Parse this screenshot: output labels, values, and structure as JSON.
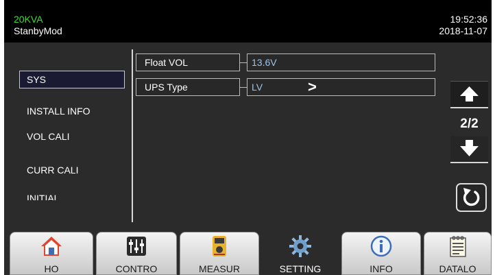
{
  "status": {
    "capacity": "20KVA",
    "mode": "StanbyMod",
    "time": "19:52:36",
    "date": "2018-11-07",
    "capacity_color": "#3ddb3d"
  },
  "sidebar": {
    "items": [
      {
        "label": "SYS",
        "active": true
      },
      {
        "label": "INSTALL INFO",
        "active": false
      },
      {
        "label": "VOL CALI",
        "active": false
      },
      {
        "label": "CURR CALI",
        "active": false
      },
      {
        "label": "INITIAL",
        "active": false
      }
    ]
  },
  "params": [
    {
      "label": "Float VOL",
      "value": "13.6V"
    },
    {
      "label": "UPS Type",
      "value": "LV",
      "arrow": ">"
    }
  ],
  "pager": {
    "indicator": "2/2",
    "up_icon": "arrow-up-icon",
    "down_icon": "arrow-down-icon",
    "refresh_icon": "refresh-icon"
  },
  "nav": {
    "items": [
      {
        "label": "HO",
        "icon": "home-icon"
      },
      {
        "label": "CONTRO",
        "icon": "control-sliders-icon"
      },
      {
        "label": "MEASUR",
        "icon": "multimeter-icon"
      },
      {
        "label": "SETTING",
        "icon": "gear-icon",
        "active": true
      },
      {
        "label": "INFO",
        "icon": "info-icon"
      },
      {
        "label": "DATALO",
        "icon": "data-log-icon"
      }
    ]
  },
  "colors": {
    "value_text": "#9ec4e8",
    "background": "#2b2b2b",
    "topbar": "#000000"
  }
}
